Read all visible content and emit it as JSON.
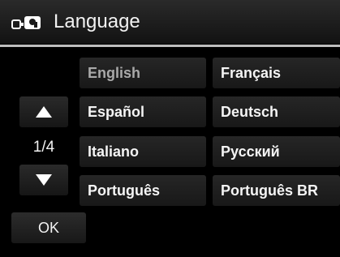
{
  "header": {
    "icon": "camera-setup-icon",
    "title": "Language"
  },
  "pager": {
    "up_icon": "triangle-up-icon",
    "down_icon": "triangle-down-icon",
    "page": "1/4"
  },
  "languages": [
    {
      "label": "English",
      "selected": true
    },
    {
      "label": "Français",
      "selected": false
    },
    {
      "label": "Español",
      "selected": false
    },
    {
      "label": "Deutsch",
      "selected": false
    },
    {
      "label": "Italiano",
      "selected": false
    },
    {
      "label": "Русский",
      "selected": false
    },
    {
      "label": "Português",
      "selected": false
    },
    {
      "label": "Português BR",
      "selected": false
    }
  ],
  "footer": {
    "ok_label": "OK"
  },
  "colors": {
    "background": "#000000",
    "button": "#1f1f1f",
    "selected_text": "#a9a9a9",
    "text": "#f4f4f4",
    "divider": "#bdbdbd"
  }
}
